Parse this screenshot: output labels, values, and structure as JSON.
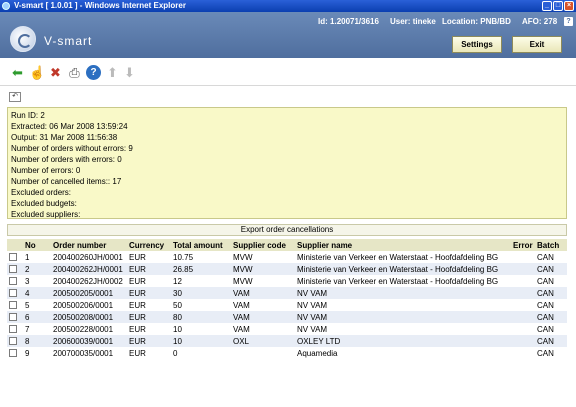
{
  "window": {
    "title": "V-smart [ 1.0.01 ] - Windows Internet Explorer"
  },
  "header": {
    "brand": "V-smart",
    "id_label": "Id:",
    "id_value": "1.20071/3616",
    "user_label": "User:",
    "user_value": "tineke",
    "location_label": "Location:",
    "location_value": "PNB/BD",
    "afo_label": "AFO:",
    "afo_value": "278",
    "help": "?",
    "settings_label": "Settings",
    "exit_label": "Exit"
  },
  "toolbar": {
    "icons": [
      "back-arrow-icon",
      "hand-icon",
      "delete-icon",
      "print-icon",
      "help-icon",
      "up-arrow-icon",
      "down-arrow-icon"
    ]
  },
  "run_info": [
    "Run ID: 2",
    "Extracted: 06 Mar 2008 13:59:24",
    "Output: 31 Mar 2008 11:56:38",
    "Number of orders without errors: 9",
    "Number of orders with errors: 0",
    "Number of errors: 0",
    "Number of cancelled items:: 17",
    "Excluded orders:",
    "Excluded budgets:",
    "Excluded suppliers:"
  ],
  "export_label": "Export order cancellations",
  "table": {
    "columns": [
      "",
      "No",
      "Order number",
      "Currency",
      "Total amount",
      "Supplier code",
      "Supplier name",
      "Error",
      "Batch"
    ],
    "rows": [
      [
        "1",
        "200400260JH/0001",
        "EUR",
        "10.75",
        "MVW",
        "Ministerie van Verkeer en Waterstaat - Hoofdafdeling BG",
        "",
        "CAN"
      ],
      [
        "2",
        "200400262JH/0001",
        "EUR",
        "26.85",
        "MVW",
        "Ministerie van Verkeer en Waterstaat - Hoofdafdeling BG",
        "",
        "CAN"
      ],
      [
        "3",
        "200400262JH/0002",
        "EUR",
        "12",
        "MVW",
        "Ministerie van Verkeer en Waterstaat - Hoofdafdeling BG",
        "",
        "CAN"
      ],
      [
        "4",
        "200500205/0001",
        "EUR",
        "30",
        "VAM",
        "NV VAM",
        "",
        "CAN"
      ],
      [
        "5",
        "200500206/0001",
        "EUR",
        "50",
        "VAM",
        "NV VAM",
        "",
        "CAN"
      ],
      [
        "6",
        "200500208/0001",
        "EUR",
        "80",
        "VAM",
        "NV VAM",
        "",
        "CAN"
      ],
      [
        "7",
        "200500228/0001",
        "EUR",
        "10",
        "VAM",
        "NV VAM",
        "",
        "CAN"
      ],
      [
        "8",
        "200600039/0001",
        "EUR",
        "10",
        "OXL",
        "OXLEY LTD",
        "",
        "CAN"
      ],
      [
        "9",
        "200700035/0001",
        "EUR",
        "0",
        "",
        "Aquamedia",
        "",
        "CAN"
      ]
    ]
  },
  "colors": {
    "header": "#5a7aab",
    "panel": "#f9f9c8",
    "row_alt": "#e8edf6",
    "table_header": "#e6e6c6"
  }
}
